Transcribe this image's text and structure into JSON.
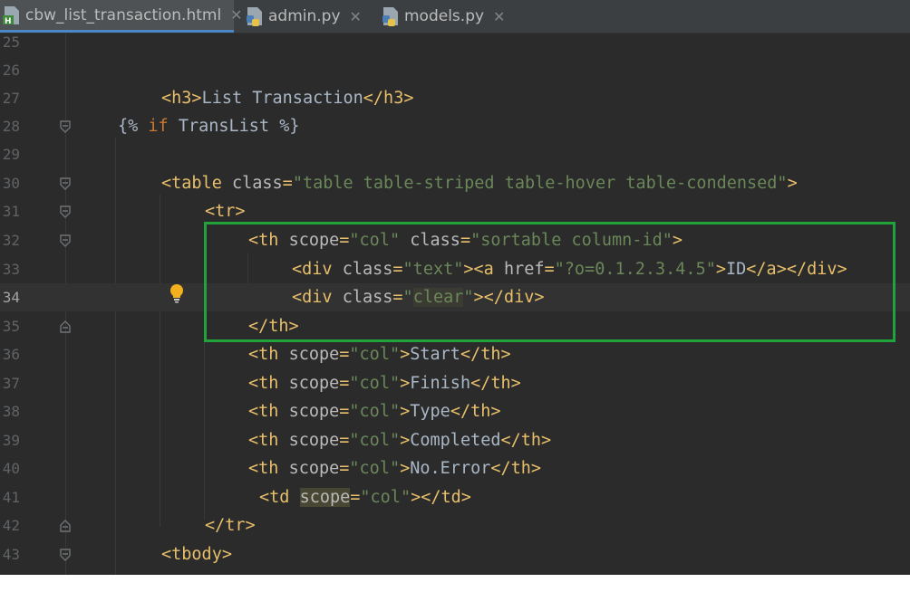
{
  "tabs": [
    {
      "label": "cbw_list_transaction.html",
      "icon": "html-file-icon",
      "active": true
    },
    {
      "label": "admin.py",
      "icon": "python-file-icon",
      "active": false
    },
    {
      "label": "models.py",
      "icon": "python-file-icon",
      "active": false
    }
  ],
  "close_glyph": "✕",
  "line_numbers": [
    "25",
    "26",
    "27",
    "28",
    "29",
    "30",
    "31",
    "32",
    "33",
    "34",
    "35",
    "36",
    "37",
    "38",
    "39",
    "40",
    "41",
    "42",
    "43"
  ],
  "code": {
    "l27": {
      "open": "<h3>",
      "text": "List Transaction",
      "close": "</h3>"
    },
    "l28": {
      "a": "{% ",
      "b": "if",
      "c": " TransList %}"
    },
    "l30": {
      "open": "<table ",
      "attr": "class",
      "eq": "=",
      "val": "\"table table-striped table-hover table-condensed\"",
      "end": ">"
    },
    "l31": {
      "tag": "<tr>"
    },
    "l32": {
      "open": "<th ",
      "a1": "scope",
      "eq1": "=",
      "v1": "\"col\"",
      "sp": " ",
      "a2": "class",
      "eq2": "=",
      "v2": "\"sortable column-id\"",
      "end": ">"
    },
    "l33": {
      "open": "<div ",
      "a1": "class",
      "eq1": "=",
      "v1": "\"text\"",
      "gt": "><a ",
      "a2": "href",
      "eq2": "=",
      "v2": "\"?o=0.1.2.3.4.5\"",
      "gt2": ">",
      "text": "ID",
      "close": "</a></div>"
    },
    "l34": {
      "open": "<div ",
      "a1": "class",
      "eq1": "=",
      "q1": "\"",
      "word": "clear",
      "q2": "\"",
      "close": "></div>"
    },
    "l35": {
      "tag": "</th>"
    },
    "l36": {
      "open": "<th ",
      "a": "scope",
      "eq": "=",
      "v": "\"col\"",
      "gt": ">",
      "text": "Start",
      "close": "</th>"
    },
    "l37": {
      "open": "<th ",
      "a": "scope",
      "eq": "=",
      "v": "\"col\"",
      "gt": ">",
      "text": "Finish",
      "close": "</th>"
    },
    "l38": {
      "open": "<th ",
      "a": "scope",
      "eq": "=",
      "v": "\"col\"",
      "gt": ">",
      "text": "Type",
      "close": "</th>"
    },
    "l39": {
      "open": "<th ",
      "a": "scope",
      "eq": "=",
      "v": "\"col\"",
      "gt": ">",
      "text": "Completed",
      "close": "</th>"
    },
    "l40": {
      "open": "<th ",
      "a": "scope",
      "eq": "=",
      "v": "\"col\"",
      "gt": ">",
      "text": "No.Error",
      "close": "</th>"
    },
    "l41": {
      "open": "<td ",
      "a": "scope",
      "eq": "=",
      "v": "\"col\"",
      "close": "></td>"
    },
    "l42": {
      "tag": "</tr>"
    },
    "l43": {
      "tag": "<tbody>"
    }
  },
  "colors": {
    "background": "#2b2b2b",
    "tag": "#e8bf6a",
    "attribute": "#bababa",
    "string": "#6a8759",
    "keyword": "#cc7832",
    "annotation_box": "#1fa33a"
  }
}
